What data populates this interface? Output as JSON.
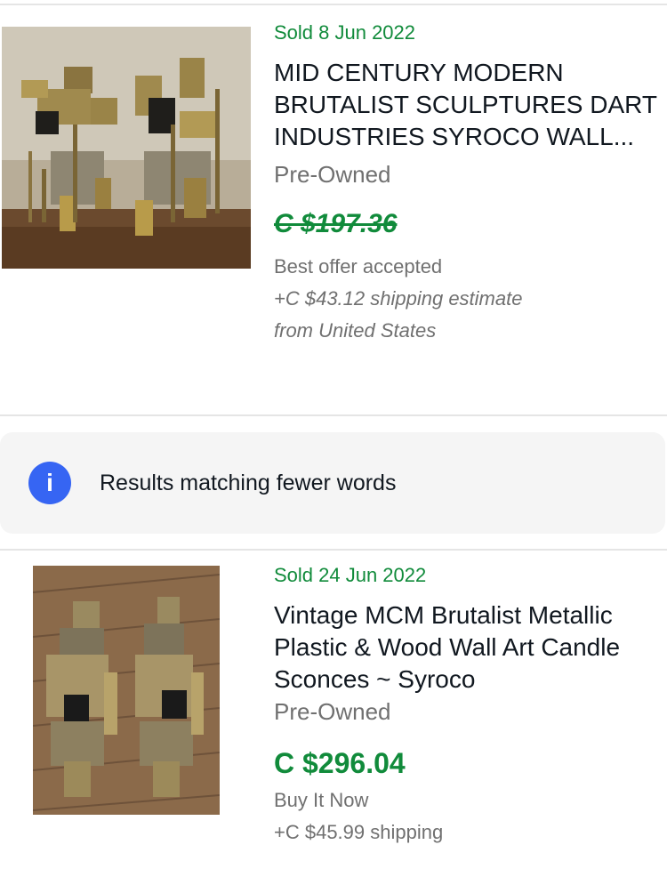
{
  "listings": [
    {
      "sold_label": "Sold 8 Jun 2022",
      "title_line1": "MID CENTURY MODERN",
      "title_line2": "BRUTALIST SCULPTURES DART",
      "title_line3": "INDUSTRIES SYROCO WALL...",
      "condition": "Pre-Owned",
      "price": "C $197.36",
      "price_struck": true,
      "purchase_type": "Best offer accepted",
      "shipping": "+C $43.12 shipping estimate",
      "location": "from United States",
      "image_icon": "brutalist-sculpture-photo"
    },
    {
      "sold_label": "Sold 24 Jun 2022",
      "title_line1": "Vintage MCM Brutalist Metallic",
      "title_line2": "Plastic & Wood Wall Art Candle",
      "title_line3": "Sconces ~ Syroco",
      "condition": "Pre-Owned",
      "price": "C $296.04",
      "price_struck": false,
      "purchase_type": "Buy It Now",
      "shipping": "+C $45.99 shipping",
      "image_icon": "wall-sconces-photo"
    }
  ],
  "notice": {
    "icon": "info-icon",
    "icon_glyph": "i",
    "text": "Results matching fewer words"
  },
  "colors": {
    "sold_green": "#118b3b",
    "price_green": "#118b3b",
    "secondary_gray": "#707070",
    "info_blue": "#3665f3",
    "notice_bg": "#f5f5f5"
  }
}
